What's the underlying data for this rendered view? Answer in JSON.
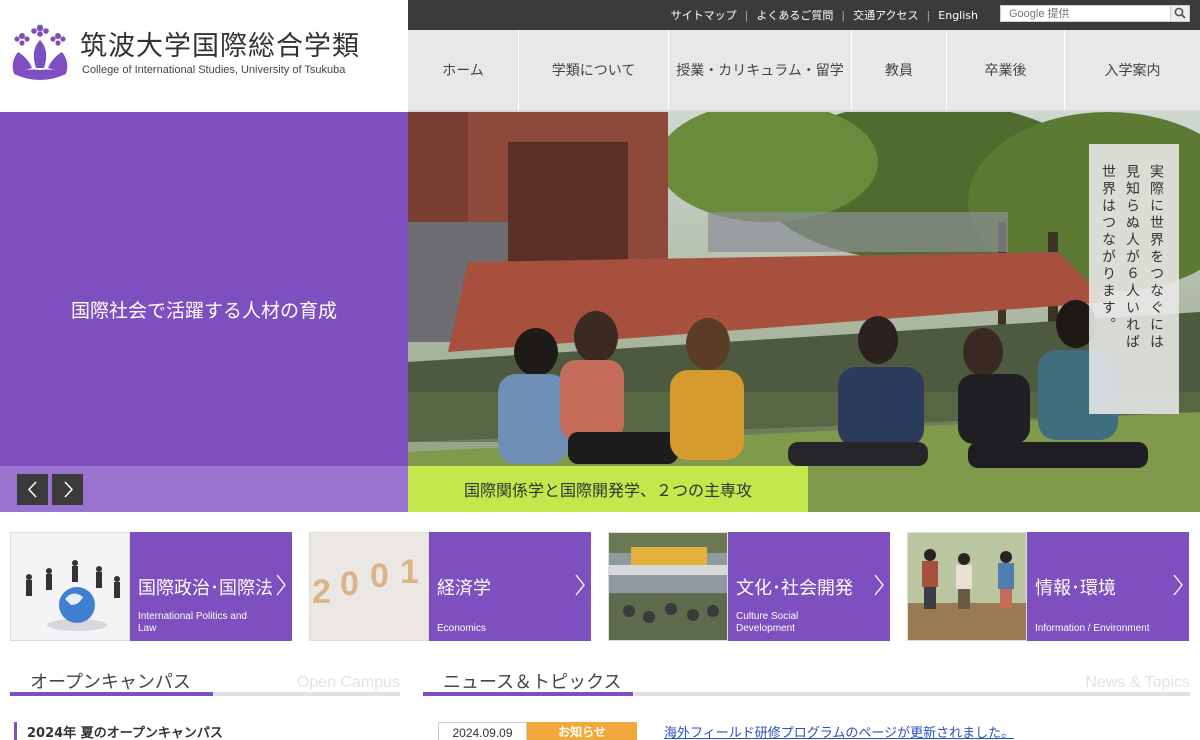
{
  "header": {
    "logo_jp": "筑波大学国際総合学類",
    "logo_en": "College of International Studies, University of Tsukuba",
    "util_links": [
      "サイトマップ",
      "よくあるご質問",
      "交通アクセス",
      "English"
    ],
    "search_placeholder": "Google 提供",
    "nav": [
      "ホーム",
      "学類について",
      "授業・カリキュラム・留学",
      "教員",
      "卒業後",
      "入学案内"
    ]
  },
  "hero": {
    "tagline": "国際社会で活躍する人材の育成",
    "caption": "国際関係学と国際開発学、２つの主専攻",
    "vertical_text": [
      "実際に世界をつなぐには",
      "見知らぬ人が６人いれば",
      "世界はつながります。"
    ],
    "prev_icon": "chevron-left-icon",
    "next_icon": "chevron-right-icon"
  },
  "categories": [
    {
      "jp": "国際政治･国際法",
      "en": "International Politics and Law"
    },
    {
      "jp": "経済学",
      "en": "Economics"
    },
    {
      "jp": "文化･社会開発",
      "en": "Culture Social Development"
    },
    {
      "jp": "情報･環境",
      "en": "Information / Environment"
    }
  ],
  "open_campus": {
    "title": "オープンキャンパス",
    "subtitle": "Open Campus",
    "item": "2024年  夏のオープンキャンパス"
  },
  "news": {
    "title": "ニュース＆トピックス",
    "subtitle": "News & Topics",
    "items": [
      {
        "date": "2024.09.09",
        "category": "お知らせ",
        "text": "海外フィールド研修プログラムのページが更新されました。"
      }
    ]
  },
  "colors": {
    "accent": "#7d4fbf",
    "accent_light": "#9a72cf",
    "caption_green": "#c2e84c",
    "topbar": "#3b3b3b",
    "news_badge": "#f0a93a",
    "link": "#2a52be"
  }
}
